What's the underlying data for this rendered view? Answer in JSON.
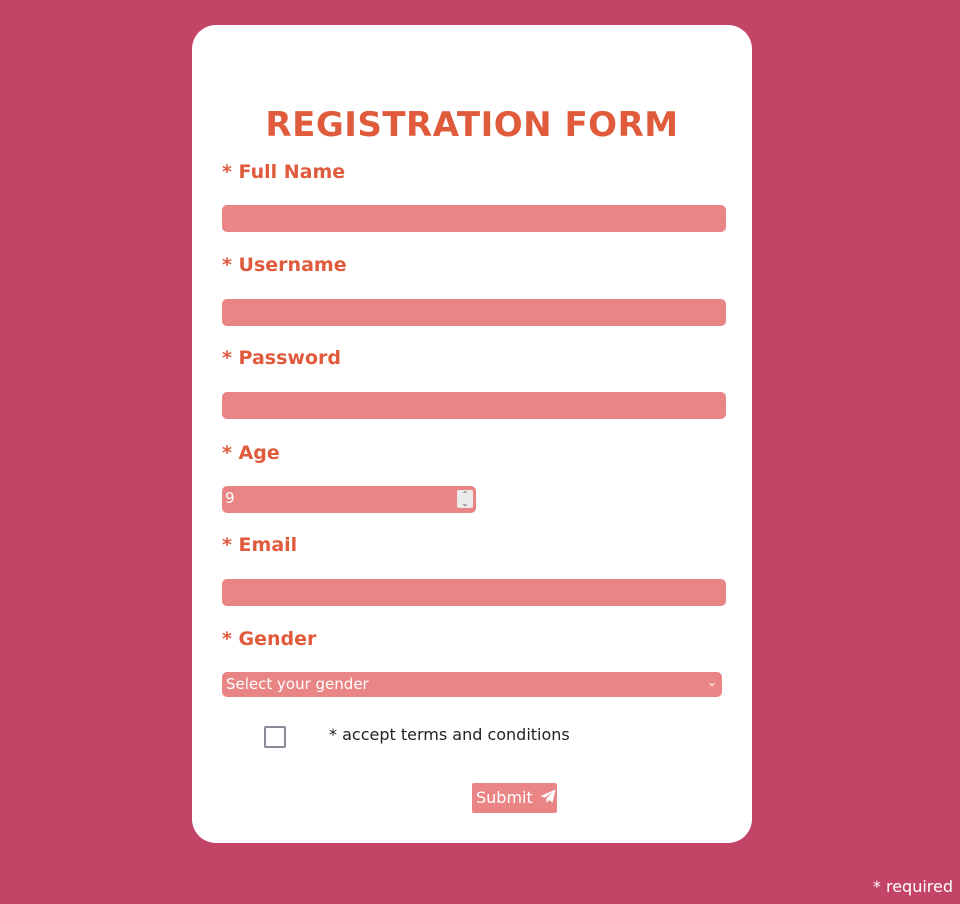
{
  "form": {
    "title": "Registration Form",
    "fields": {
      "full_name": {
        "label": "* Full Name",
        "value": ""
      },
      "username": {
        "label": "* Username",
        "value": ""
      },
      "password": {
        "label": "* Password",
        "value": ""
      },
      "age": {
        "label": "* Age",
        "value": "9"
      },
      "email": {
        "label": "* Email",
        "value": ""
      },
      "gender": {
        "label": "* Gender",
        "selected": "Select your gender"
      }
    },
    "terms_label": "* accept terms and conditions",
    "submit_label": "Submit"
  },
  "footer": {
    "required_note": "* required"
  },
  "icons": {
    "submit": "paper-plane-icon",
    "select": "chevron-down-icon"
  },
  "colors": {
    "background": "#c44467",
    "accent": "#e05a3c",
    "field": "#e98585"
  }
}
